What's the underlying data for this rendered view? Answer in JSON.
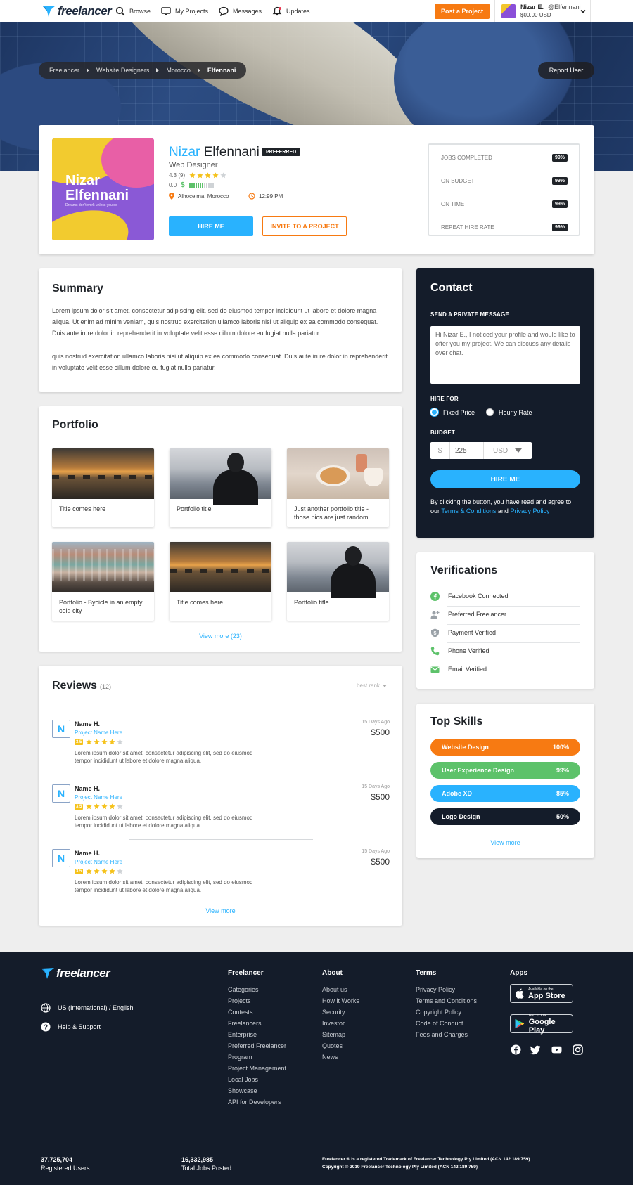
{
  "nav": {
    "logo": "freelancer",
    "items": [
      {
        "label": "Browse",
        "icon": "search-icon"
      },
      {
        "label": "My Projects",
        "icon": "monitor-icon"
      },
      {
        "label": "Messages",
        "icon": "chat-icon"
      },
      {
        "label": "Updates",
        "icon": "bell-icon"
      }
    ],
    "post_button": "Post a Project",
    "user": {
      "name": "Nizar E.",
      "handle": "@Elfennani",
      "balance": "$00.00 USD"
    }
  },
  "hero": {
    "breadcrumb": [
      "Freelancer",
      "Website Designers",
      "Morocco",
      "Elfennani"
    ],
    "report_button": "Report User"
  },
  "profile": {
    "image_text_line1": "Nizar",
    "image_text_line2": "Elfennani",
    "image_tagline": "Dreams don't work unless you do",
    "first_name": "Nizar",
    "last_name": "Elfennani",
    "badge": "PREFERRED",
    "title": "Web Designer",
    "rating": "4.3 (9)",
    "rating_stars": 4,
    "earnings_score": "0.0",
    "earnings_level": 0.6,
    "location": "Alhoceima, Morocco",
    "local_time": "12:99 PM",
    "hire_button": "HIRE ME",
    "invite_button": "INVITE TO A PROJECT",
    "stats": [
      {
        "label": "JOBS COMPLETED",
        "value": "99%"
      },
      {
        "label": "ON BUDGET",
        "value": "99%"
      },
      {
        "label": "ON TIME",
        "value": "99%"
      },
      {
        "label": "REPEAT HIRE RATE",
        "value": "99%"
      }
    ]
  },
  "summary": {
    "heading": "Summary",
    "para1": "Lorem ipsum dolor sit amet, consectetur adipiscing elit, sed do eiusmod tempor incididunt ut labore et dolore magna aliqua. Ut enim ad minim veniam, quis nostrud exercitation ullamco laboris nisi ut aliquip ex ea commodo consequat. Duis aute irure dolor in reprehenderit in voluptate velit esse cillum dolore eu fugiat nulla pariatur.",
    "para2": "quis nostrud exercitation ullamco laboris nisi ut aliquip ex ea commodo consequat. Duis aute irure dolor in reprehenderit in voluptate velit esse cillum dolore eu fugiat nulla pariatur."
  },
  "portfolio": {
    "heading": "Portfolio",
    "items": [
      {
        "title": "Title comes here"
      },
      {
        "title": "Portfolio title"
      },
      {
        "title": "Just another portfolio title - those pics are just random"
      },
      {
        "title": "Portfolio - Bycicle in an empty cold city"
      },
      {
        "title": "Title comes here"
      },
      {
        "title": "Portfolio title"
      }
    ],
    "view_more": "View more (23)"
  },
  "reviews": {
    "heading": "Reviews",
    "count": "(12)",
    "sort": "best rank",
    "items": [
      {
        "initial": "N",
        "name": "Name H.",
        "project": "Project Name Here",
        "score": "3.5",
        "stars": 4,
        "text": "Lorem ipsum dolor sit amet, consectetur adipiscing elit, sed do eiusmod tempor incididunt ut labore et dolore magna aliqua.",
        "date": "15 Days Ago",
        "amount": "$500"
      },
      {
        "initial": "N",
        "name": "Name H.",
        "project": "Project Name Here",
        "score": "3.5",
        "stars": 4,
        "text": "Lorem ipsum dolor sit amet, consectetur adipiscing elit, sed do eiusmod tempor incididunt ut labore et dolore magna aliqua.",
        "date": "15 Days Ago",
        "amount": "$500"
      },
      {
        "initial": "N",
        "name": "Name H.",
        "project": "Project Name Here",
        "score": "3.5",
        "stars": 4,
        "text": "Lorem ipsum dolor sit amet, consectetur adipiscing elit, sed do eiusmod tempor incididunt ut labore et dolore magna aliqua.",
        "date": "15 Days Ago",
        "amount": "$500"
      }
    ],
    "view_more": "View more"
  },
  "contact": {
    "heading": "Contact",
    "message_label": "SEND A PRIVATE MESSAGE",
    "message_value": "Hi Nizar E., I noticed your profile and would like to offer you my project. We can discuss any details over chat.",
    "hire_for_label": "HIRE FOR",
    "option_fixed": "Fixed Price",
    "option_hourly": "Hourly Rate",
    "selected": "Fixed Price",
    "budget_label": "BUDGET",
    "currency_symbol": "$",
    "budget_value": "225",
    "currency": "USD",
    "hire_button": "HIRE ME",
    "terms_prefix": "By clicking the button, you have read and agree to our",
    "terms_link": "Terms & Conditions",
    "terms_and": "and",
    "privacy_link": "Privacy Policy"
  },
  "verifications": {
    "heading": "Verifications",
    "items": [
      {
        "label": "Facebook Connected",
        "icon": "facebook-icon",
        "color": "#5dc26a"
      },
      {
        "label": "Preferred Freelancer",
        "icon": "user-plus-icon",
        "color": "#9aa1a7"
      },
      {
        "label": "Payment Verified",
        "icon": "shield-dollar-icon",
        "color": "#9aa1a7"
      },
      {
        "label": "Phone Verified",
        "icon": "phone-icon",
        "color": "#5dc26a"
      },
      {
        "label": "Email Verified",
        "icon": "envelope-icon",
        "color": "#5dc26a"
      }
    ]
  },
  "skills": {
    "heading": "Top Skills",
    "items": [
      {
        "name": "Website Design",
        "value": "100%",
        "color": "#f77a12"
      },
      {
        "name": "User Experience Design",
        "value": "99%",
        "color": "#5dc26a"
      },
      {
        "name": "Adobe XD",
        "value": "85%",
        "color": "#29b2fe"
      },
      {
        "name": "Logo Design",
        "value": "50%",
        "color": "#141c2a"
      }
    ],
    "view_more": "View more"
  },
  "footer": {
    "logo": "freelancer",
    "locale": "US (International) / English",
    "help": "Help & Support",
    "columns": [
      {
        "title": "Freelancer",
        "links": [
          "Categories",
          "Projects",
          "Contests",
          "Freelancers",
          "Enterprise",
          "Preferred Freelancer Program",
          "Project Management",
          "Local Jobs",
          "Showcase",
          "API for Developers"
        ]
      },
      {
        "title": "About",
        "links": [
          "About us",
          "How it Works",
          "Security",
          "Investor",
          "Sitemap",
          "Quotes",
          "News"
        ]
      },
      {
        "title": "Terms",
        "links": [
          "Privacy Policy",
          "Terms and Conditions",
          "Copyright Policy",
          "Code of Conduct",
          "Fees and Charges"
        ]
      }
    ],
    "apps_title": "Apps",
    "app_store_small": "Available on the",
    "app_store": "App Store",
    "google_play_small": "GET IT ON",
    "google_play": "Google Play",
    "stat1_value": "37,725,704",
    "stat1_label": "Registered Users",
    "stat2_value": "16,332,985",
    "stat2_label": "Total Jobs Posted",
    "legal1": "Freelancer ® is a registered Trademark of Freelancer Technology Pty Limited (ACN 142 189 759)",
    "legal2": "Copyright © 2019 Freelancer Technology Pty Limited (ACN 142 189 759)"
  }
}
